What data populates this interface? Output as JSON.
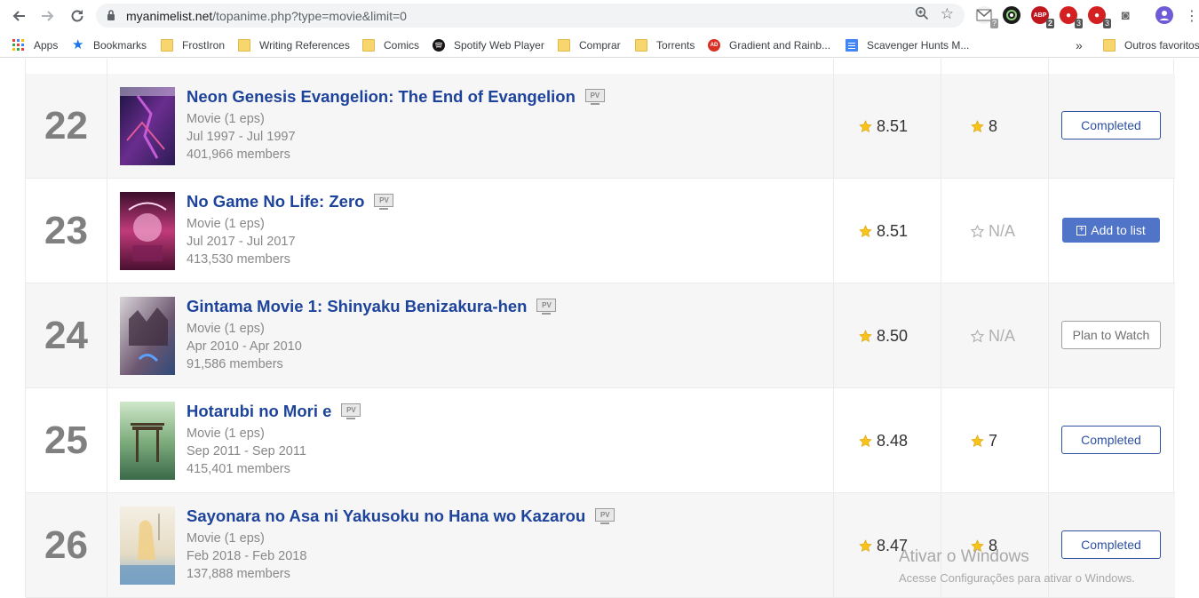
{
  "browser": {
    "url_host": "myanimelist.net",
    "url_path": "/topanime.php?type=movie&limit=0",
    "extensions": [
      {
        "name": "gmail-ext",
        "badge": "",
        "color": "#6b6b6b"
      },
      {
        "name": "dark-ext",
        "badge": "",
        "color": "#1b1b1b"
      },
      {
        "name": "abp-ext",
        "badge": "2",
        "color": "#c0171f"
      },
      {
        "name": "red-ext-1",
        "badge": "3",
        "color": "#d42020"
      },
      {
        "name": "red-ext-2",
        "badge": "3",
        "color": "#d42020"
      }
    ]
  },
  "bookmarks": {
    "apps": "Apps",
    "items": [
      "Bookmarks",
      "FrostIron",
      "Writing References",
      "Comics",
      "Spotify Web Player",
      "Comprar",
      "Torrents",
      "Gradient and Rainb...",
      "Scavenger Hunts M..."
    ],
    "overflow": "»",
    "other": "Outros favoritos"
  },
  "rows": [
    {
      "rank": "22",
      "title": "Neon Genesis Evangelion: The End of Evangelion",
      "pv": "PV",
      "type": "Movie (1 eps)",
      "aired": "Jul 1997 - Jul 1997",
      "members": "401,966 members",
      "score": "8.51",
      "my_score": "8",
      "status": "Completed"
    },
    {
      "rank": "23",
      "title": "No Game No Life: Zero",
      "pv": "PV",
      "type": "Movie (1 eps)",
      "aired": "Jul 2017 - Jul 2017",
      "members": "413,530 members",
      "score": "8.51",
      "my_score": "N/A",
      "status": "Add to list"
    },
    {
      "rank": "24",
      "title": "Gintama Movie 1: Shinyaku Benizakura-hen",
      "pv": "PV",
      "type": "Movie (1 eps)",
      "aired": "Apr 2010 - Apr 2010",
      "members": "91,586 members",
      "score": "8.50",
      "my_score": "N/A",
      "status": "Plan to Watch"
    },
    {
      "rank": "25",
      "title": "Hotarubi no Mori e",
      "pv": "PV",
      "type": "Movie (1 eps)",
      "aired": "Sep 2011 - Sep 2011",
      "members": "415,401 members",
      "score": "8.48",
      "my_score": "7",
      "status": "Completed"
    },
    {
      "rank": "26",
      "title": "Sayonara no Asa ni Yakusoku no Hana wo Kazarou",
      "pv": "PV",
      "type": "Movie (1 eps)",
      "aired": "Feb 2018 - Feb 2018",
      "members": "137,888 members",
      "score": "8.47",
      "my_score": "8",
      "status": "Completed"
    }
  ],
  "watermark": {
    "line1": "Ativar o Windows",
    "line2": "Acesse Configurações para ativar o Windows."
  },
  "colors": {
    "title_link": "#1d439b",
    "star": "#f8c41c",
    "button_primary": "#4f74c8"
  }
}
